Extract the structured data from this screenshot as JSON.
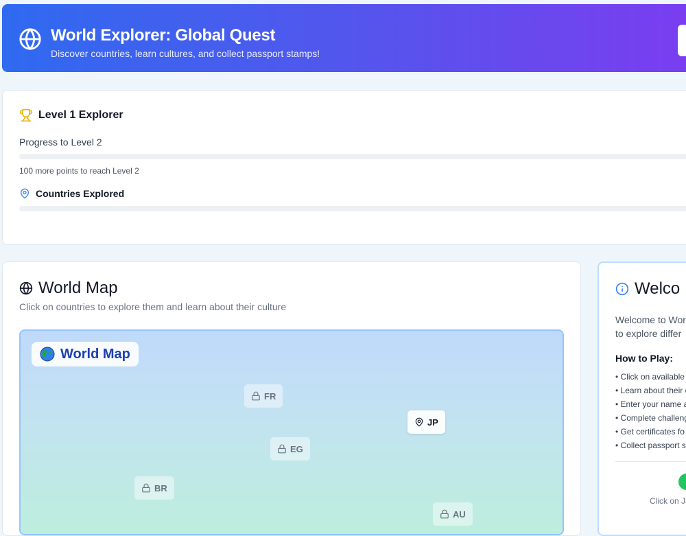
{
  "header": {
    "title": "World Explorer: Global Quest",
    "subtitle": "Discover countries, learn cultures, and collect passport stamps!"
  },
  "progress": {
    "level_title": "Level 1 Explorer",
    "progress_label": "Progress to Level 2",
    "level_progress_fraction": 0,
    "points_hint": "100 more points to reach Level 2",
    "countries_label": "Countries Explored",
    "countries_progress_fraction": 0
  },
  "map": {
    "title": "World Map",
    "description": "Click on countries to explore them and learn about their culture",
    "badge": "World Map",
    "countries": [
      {
        "code": "FR",
        "status": "locked"
      },
      {
        "code": "JP",
        "status": "available"
      },
      {
        "code": "EG",
        "status": "locked"
      },
      {
        "code": "BR",
        "status": "locked"
      },
      {
        "code": "AU",
        "status": "locked"
      }
    ]
  },
  "welcome": {
    "title": "Welco",
    "line1": "Welcome to Wor",
    "line2": "to explore differ",
    "how_to_play": "How to Play:",
    "steps": [
      "• Click on available",
      "• Learn about their c",
      "• Enter your name a",
      "• Complete challeng",
      "• Get certificates fo",
      "• Collect passport s"
    ],
    "click_hint": "Click on Ja"
  },
  "colors": {
    "header_gradient_start": "#2f6af0",
    "header_gradient_end": "#7b3df0",
    "trophy": "#eab308",
    "pin_accent": "#3b82f6",
    "map_badge_text": "#1e40af",
    "success_dot": "#22c55e"
  },
  "icons": {
    "header": "globe-icon",
    "level": "trophy-icon",
    "countries": "map-pin-icon",
    "map_title": "globe-icon",
    "map_badge": "earth-globe-icon",
    "locked_country": "lock-icon",
    "open_country": "map-pin-icon",
    "welcome": "info-icon"
  }
}
